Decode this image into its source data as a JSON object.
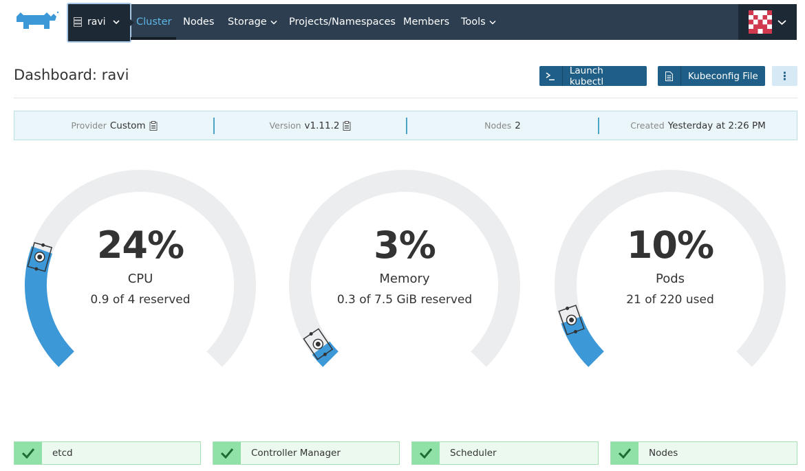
{
  "header": {
    "cluster_name": "ravi",
    "nav": [
      {
        "label": "Cluster",
        "active": true,
        "dropdown": false
      },
      {
        "label": "Nodes",
        "active": false,
        "dropdown": false
      },
      {
        "label": "Storage",
        "active": false,
        "dropdown": true
      },
      {
        "label": "Projects/Namespaces",
        "active": false,
        "dropdown": false
      },
      {
        "label": "Members",
        "active": false,
        "dropdown": false
      },
      {
        "label": "Tools",
        "active": false,
        "dropdown": true
      }
    ],
    "user_menu_icon": "chevron-down-icon"
  },
  "page": {
    "title": "Dashboard: ravi",
    "launch_kubectl_label": "Launch kubectl",
    "kubeconfig_label": "Kubeconfig File",
    "more_label": "⋮"
  },
  "info": {
    "provider_key": "Provider",
    "provider_value": "Custom",
    "version_key": "Version",
    "version_value": "v1.11.2",
    "nodes_key": "Nodes",
    "nodes_value": "2",
    "created_key": "Created",
    "created_value": "Yesterday at 2:26 PM"
  },
  "gauges": [
    {
      "percent_label": "24%",
      "label": "CPU",
      "detail": "0.9 of 4 reserved",
      "fill_fraction": 0.24,
      "reserved_fraction": 0.225
    },
    {
      "percent_label": "3%",
      "label": "Memory",
      "detail": "0.3 of 7.5 GiB reserved",
      "fill_fraction": 0.03,
      "reserved_fraction": 0.04
    },
    {
      "percent_label": "10%",
      "label": "Pods",
      "detail": "21 of 220 used",
      "fill_fraction": 0.095,
      "reserved_fraction": 0.095
    }
  ],
  "components": [
    {
      "label": "etcd",
      "status": "healthy"
    },
    {
      "label": "Controller Manager",
      "status": "healthy"
    },
    {
      "label": "Scheduler",
      "status": "healthy"
    },
    {
      "label": "Nodes",
      "status": "healthy"
    }
  ],
  "colors": {
    "navbar": "#2c3e50",
    "accent": "#5fb7e6",
    "button": "#1f5f87",
    "gauge_fill": "#3d98d8",
    "gauge_track": "#ebedef",
    "healthy": "#8fe1a8"
  }
}
